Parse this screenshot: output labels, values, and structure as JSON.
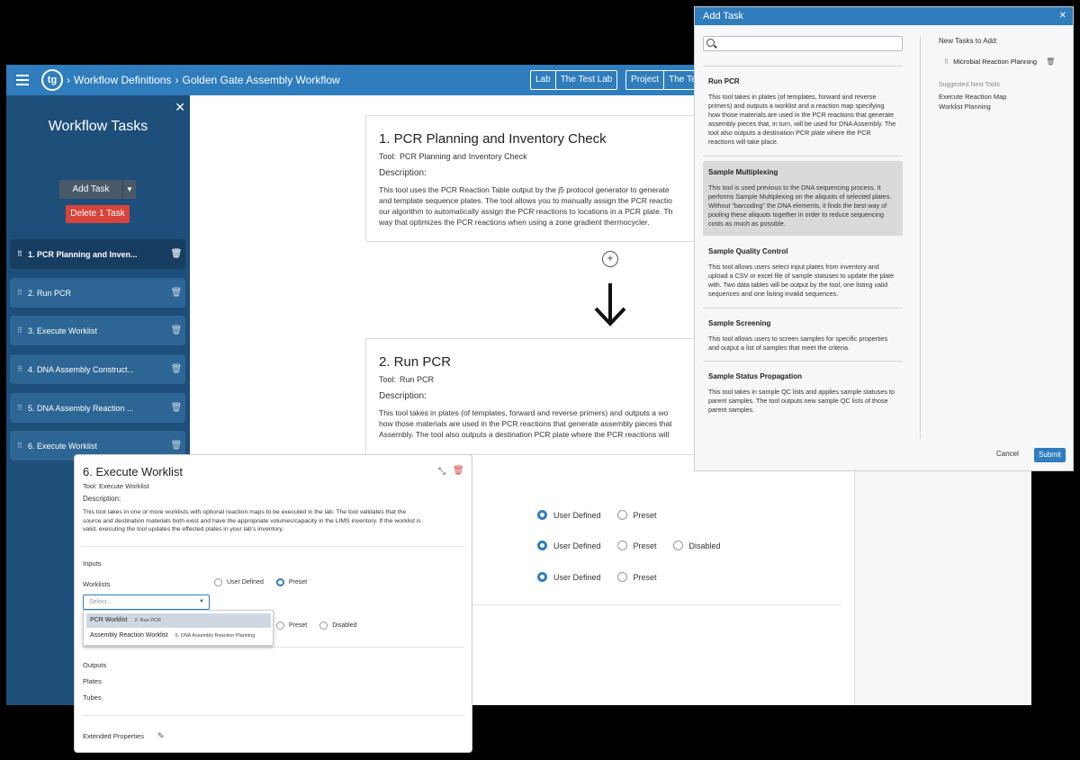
{
  "header": {
    "logo": "tg",
    "breadcrumbs": [
      "Workflow Definitions",
      "Golden Gate Assembly Workflow"
    ],
    "lab_label": "Lab",
    "lab_value": "The Test Lab",
    "project_label": "Project",
    "project_value": "The Te"
  },
  "sidebar": {
    "title": "Workflow Tasks",
    "add_task": "Add Task",
    "delete_task": "Delete 1 Task",
    "items": [
      {
        "label": "1. PCR Planning and Inven..."
      },
      {
        "label": "2. Run PCR"
      },
      {
        "label": "3. Execute Worklist"
      },
      {
        "label": "4. DNA Assembly Construct..."
      },
      {
        "label": "5. DNA Assembly Reaction ..."
      },
      {
        "label": "6. Execute Worklist"
      }
    ]
  },
  "canvas": {
    "card1": {
      "title": "1. PCR Planning and Inventory Check",
      "tool_label": "Tool:",
      "tool_value": "PCR Planning and Inventory Check",
      "desc_label": "Description:",
      "desc_lines": [
        "This tool uses the PCR Reaction Table output by the j5 protocol generator to generate",
        "and template sequence plates. The tool allows you to manually assign the PCR reactio",
        "our algorithm to automatically assign the PCR reactions to locations in a PCR plate. Th",
        "way that optimizes the PCR reactions when using a zone gradient thermocycler."
      ]
    },
    "card2": {
      "title": "2. Run PCR",
      "tool_label": "Tool:",
      "tool_value": "Run PCR",
      "desc_label": "Description:",
      "desc_lines": [
        "This tool takes in plates (of templates, forward and reverse primers) and outputs a wo",
        "how those materials are used in the PCR reactions that generate assembly pieces that",
        "Assembly. The tool also outputs a destination PCR plate where the PCR reactions will"
      ]
    },
    "radio_rows": [
      {
        "options": [
          "User Defined",
          "Preset"
        ],
        "selected": 0
      },
      {
        "options": [
          "User Defined",
          "Preset",
          "Disabled"
        ],
        "selected": 0
      },
      {
        "options": [
          "User Defined",
          "Preset"
        ],
        "selected": 0
      }
    ]
  },
  "dialog": {
    "title": "Add Task",
    "search_placeholder": "",
    "tools": [
      {
        "name": "Run PCR",
        "desc": "This tool takes in plates (of templates, forward and reverse primers) and outputs a worklist and a reaction map specifying how those materials are used in the PCR reactions that generate assembly pieces that, in turn, will be used for DNA Assembly. The tool also outputs a destination PCR plate where the PCR reactions will take place."
      },
      {
        "name": "Sample Multiplexing",
        "desc": "This tool is used previous to the DNA sequencing process. It performs Sample Multiplexing on the aliquots of selected plates. Without \"barcoding\" the DNA elements, it finds the best way of pooling these aliquots together in order to reduce sequencing costs as much as possible."
      },
      {
        "name": "Sample Quality Control",
        "desc": "This tool allows users select input plates from inventory and upload a CSV or excel file of sample statuses to update the plate with. Two data tables will be output by the tool, one listing valid sequences and one listing invalid sequences."
      },
      {
        "name": "Sample Screening",
        "desc": "This tool allows users to screen samples for specific properties and output a list of samples that meet the criteria."
      },
      {
        "name": "Sample Status Propagation",
        "desc": "This tool takes in sample QC lists and applies sample statuses to parent samples. The tool outputs new sample QC lists of those parent samples."
      }
    ],
    "new_tasks_heading": "New Tasks to Add:",
    "new_tasks": [
      "Microbial Reaction Planning"
    ],
    "suggested_heading": "Suggested Next Tools",
    "suggested": [
      "Execute Reaction Map",
      "Worklist Planning"
    ],
    "cancel": "Cancel",
    "submit": "Submit"
  },
  "panel": {
    "title": "6. Execute Worklist",
    "tool_label": "Tool:",
    "tool_value": "Execute Worklist",
    "desc_label": "Description:",
    "desc_lines": [
      "This tool takes in one or more worklists with optional reaction maps to be executed in the lab. The tool validates that the",
      "source and destination materials both exist and have the appropriate volumes/capacity in the LIMS inventory. If the worklist is",
      "valid, executing the tool updates the effected plates in your lab's inventory."
    ],
    "inputs": "Inputs",
    "worklists": "Worklists",
    "worklists_options": [
      "User Defined",
      "Preset"
    ],
    "select_placeholder": "Select...",
    "dropdown": [
      {
        "label": "PCR Worklist",
        "sub": "2. Run PCR"
      },
      {
        "label": "Assembly Reaction Worklist",
        "sub": "5. DNA Assembly Reaction Planning"
      }
    ],
    "second_options": [
      "Preset",
      "Disabled"
    ],
    "outputs": "Outputs",
    "plates": "Plates",
    "tubes": "Tubes",
    "extended": "Extended Properties"
  },
  "colors": {
    "accent": "#2f7dbd",
    "sidebar": "#1e4e7a",
    "danger": "#d8433b"
  }
}
